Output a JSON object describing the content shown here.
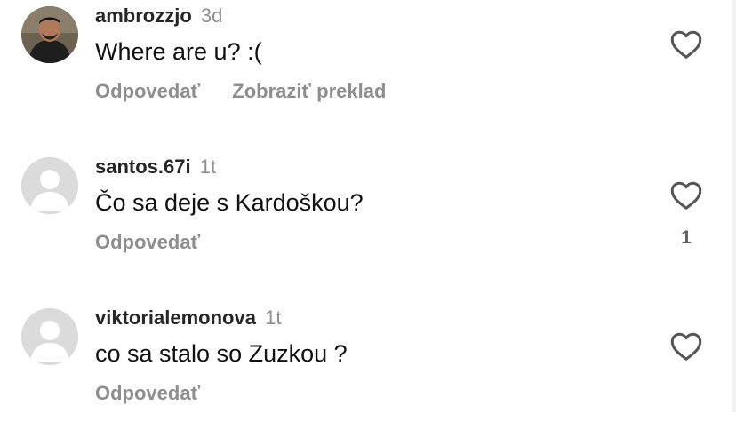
{
  "comments": [
    {
      "username": "ambrozzjo",
      "time": "3d",
      "text": "Where are u? :(",
      "reply_label": "Odpovedať",
      "translate_label": "Zobraziť preklad",
      "likes": "",
      "avatar": "profile-photo"
    },
    {
      "username": "santos.67i",
      "time": "1t",
      "text": "Čo sa deje s Kardoškou?",
      "reply_label": "Odpovedať",
      "likes": "1",
      "avatar": "default-avatar"
    },
    {
      "username": "viktorialemonova",
      "time": "1t",
      "text": "co sa stalo so Zuzkou ?",
      "reply_label": "Odpovedať",
      "likes": "",
      "avatar": "default-avatar"
    }
  ],
  "icons": {
    "like": "heart-outline-icon"
  },
  "colors": {
    "username": "#262626",
    "muted": "#8e8e8e",
    "avatar_placeholder": "#dbdbdb"
  }
}
